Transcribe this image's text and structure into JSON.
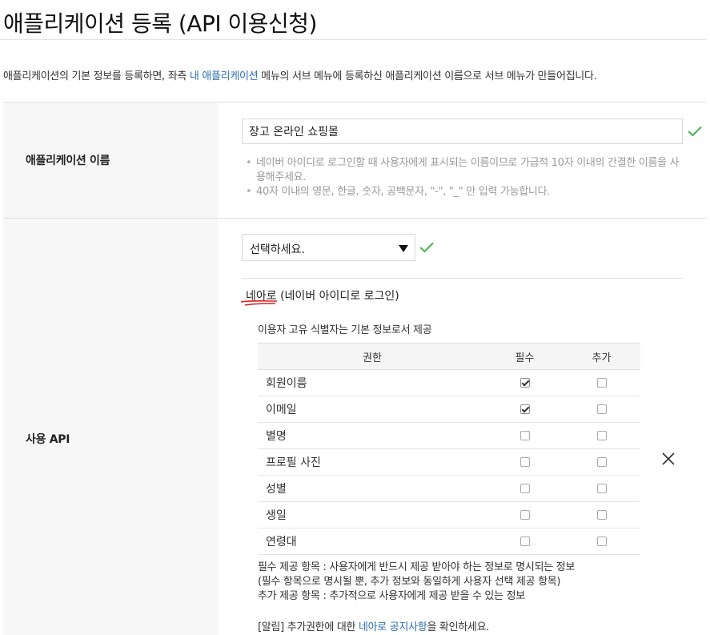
{
  "page": {
    "title": "애플리케이션 등록 (API 이용신청)",
    "intro_before": "애플리케이션의 기본 정보를 등록하면, 좌측 ",
    "intro_link": "내 애플리케이션",
    "intro_after": " 메뉴의 서브 메뉴에 등록하신 애플리케이션 이름으로 서브 메뉴가 만들어집니다."
  },
  "app_name_row": {
    "label": "애플리케이션 이름",
    "value": "장고 온라인 쇼핑몰",
    "hints": [
      "네이버 아이디로 로그인할 때 사용자에게 표시되는 이름이므로 가급적 10자 이내의 간결한 이름을 사용해주세요.",
      "40자 이내의 영문, 한글, 숫자, 공백문자, \"-\", \"_\" 만 입력 가능합니다."
    ],
    "valid_icon": "check-icon",
    "valid_color": "#4caf50"
  },
  "api_row": {
    "label": "사용 API",
    "select_value": "선택하세요.",
    "api_name": "네아로",
    "api_desc": " (네이버 아이디로 로그인)",
    "uid_note": "이용자 고유 식별자는 기본 정보로서 제공",
    "table_headers": {
      "name": "권한",
      "required": "필수",
      "additional": "추가"
    },
    "permissions": [
      {
        "name": "회원이름",
        "required": true,
        "additional": false
      },
      {
        "name": "이메일",
        "required": true,
        "additional": false
      },
      {
        "name": "별명",
        "required": false,
        "additional": false
      },
      {
        "name": "프로필 사진",
        "required": false,
        "additional": false
      },
      {
        "name": "성별",
        "required": false,
        "additional": false
      },
      {
        "name": "생일",
        "required": false,
        "additional": false
      },
      {
        "name": "연령대",
        "required": false,
        "additional": false
      }
    ],
    "notes": [
      "필수 제공 항목 : 사용자에게 반드시 제공 받아야 하는 정보로 명시되는 정보",
      "(필수 항목으로 명시될 뿐, 추가 정보와 동일하게 사용자 선택 제공 항목)",
      "추가 제공 항목 : 추가적으로 사용자에게 제공 받을 수 있는 정보"
    ],
    "notice_before": "[알림] 추가권한에 대한 ",
    "notice_link": "네아로 공지사항",
    "notice_after": "을 확인하세요.",
    "remove_icon": "close-icon",
    "underline_color": "#e02020"
  }
}
